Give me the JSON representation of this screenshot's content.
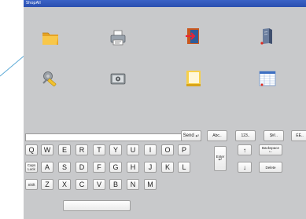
{
  "window": {
    "title": "ShopAll"
  },
  "launcher": {
    "icons": [
      {
        "name": "folder-icon"
      },
      {
        "name": "printer-icon"
      },
      {
        "name": "exit-door-icon"
      },
      {
        "name": "server-icon"
      },
      {
        "name": "tools-icon"
      },
      {
        "name": "cash-register-icon"
      },
      {
        "name": "window-frame-icon"
      },
      {
        "name": "spreadsheet-icon"
      }
    ]
  },
  "keyboard": {
    "input": {
      "value": "",
      "placeholder": ""
    },
    "send_label": "Send",
    "abc_label": "Abc..",
    "numbers_label": "123..",
    "symbols_label": "$#/..",
    "cut_off_label": "ÉÈ..",
    "row1": [
      "Q",
      "W",
      "E",
      "R",
      "T",
      "Y",
      "U",
      "I",
      "O",
      "P"
    ],
    "row2": [
      "A",
      "S",
      "D",
      "F",
      "G",
      "H",
      "J",
      "K",
      "L"
    ],
    "row3": [
      "Z",
      "X",
      "C",
      "V",
      "B",
      "N",
      "M"
    ],
    "caps_label": "Caps Lock",
    "shift_label": "Shift",
    "enter_label": "Enter",
    "up_arrow": "↑",
    "down_arrow": "↓",
    "backspace_label": "Backspace",
    "delete_label": "Delete"
  }
}
